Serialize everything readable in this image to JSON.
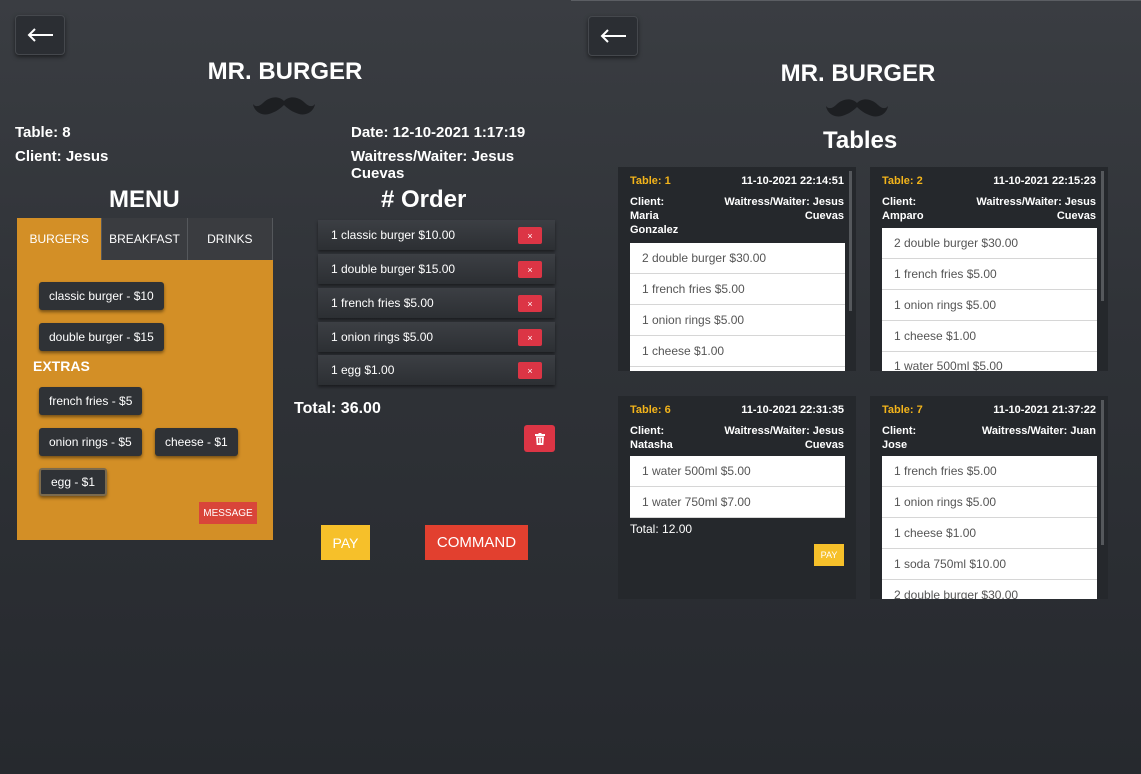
{
  "left": {
    "brand": "MR. BURGER",
    "table_label": "Table: 8",
    "client_label": "Client: Jesus",
    "date_label": "Date: 12-10-2021 1:17:19",
    "waiter_label": "Waitress/Waiter: Jesus Cuevas",
    "menu_title": "MENU",
    "order_title": "# Order",
    "tabs": [
      "BURGERS",
      "BREAKFAST",
      "DRINKS"
    ],
    "menu_items": [
      "classic burger - $10",
      "double burger - $15"
    ],
    "extras_title": "EXTRAS",
    "extras": [
      "french fries - $5",
      "onion rings - $5",
      "cheese - $1",
      "egg - $1"
    ],
    "message_label": "MESSAGE",
    "order_items": [
      {
        "text": "1 classic burger $10.00",
        "remove": "×"
      },
      {
        "text": "1 double burger $15.00",
        "remove": "×"
      },
      {
        "text": "1 french fries $5.00",
        "remove": "×"
      },
      {
        "text": "1 onion rings $5.00",
        "remove": "×"
      },
      {
        "text": "1 egg $1.00",
        "remove": "×"
      }
    ],
    "total_label": "Total: 36.00",
    "pay_label": "PAY",
    "command_label": "COMMAND"
  },
  "right": {
    "brand": "MR. BURGER",
    "title": "Tables",
    "cards": [
      {
        "table": "Table: 1",
        "date": "11-10-2021 22:14:51",
        "client": [
          "Client:",
          "Maria",
          "Gonzalez"
        ],
        "waiter": [
          "Waitress/Waiter: Jesus",
          "Cuevas"
        ],
        "items": [
          "2 double burger $30.00",
          "1 french fries $5.00",
          "1 onion rings $5.00",
          "1 cheese $1.00"
        ]
      },
      {
        "table": "Table: 2",
        "date": "11-10-2021 22:15:23",
        "client": [
          "Client:",
          "Amparo"
        ],
        "waiter": [
          "Waitress/Waiter: Jesus",
          "Cuevas"
        ],
        "items": [
          "2 double burger $30.00",
          "1 french fries $5.00",
          "1 onion rings $5.00",
          "1 cheese $1.00",
          "1 water 500ml $5.00"
        ]
      },
      {
        "table": "Table: 6",
        "date": "11-10-2021 22:31:35",
        "client": [
          "Client:",
          "Natasha"
        ],
        "waiter": [
          "Waitress/Waiter: Jesus",
          "Cuevas"
        ],
        "items": [
          "1 water 500ml $5.00",
          "1 water 750ml $7.00"
        ],
        "total": "Total: 12.00",
        "pay": "PAY"
      },
      {
        "table": "Table: 7",
        "date": "11-10-2021 21:37:22",
        "client": [
          "Client:",
          "Jose"
        ],
        "waiter": [
          "Waitress/Waiter: Juan"
        ],
        "items": [
          "1 french fries $5.00",
          "1 onion rings $5.00",
          "1 cheese $1.00",
          "1 soda 750ml $10.00",
          "2 double burger $30.00"
        ]
      }
    ]
  },
  "colors": {
    "menu_orange": "#d38f26",
    "accent_yellow": "#f6c02a",
    "danger_red": "#dc3545",
    "command_red": "#e2402f"
  }
}
